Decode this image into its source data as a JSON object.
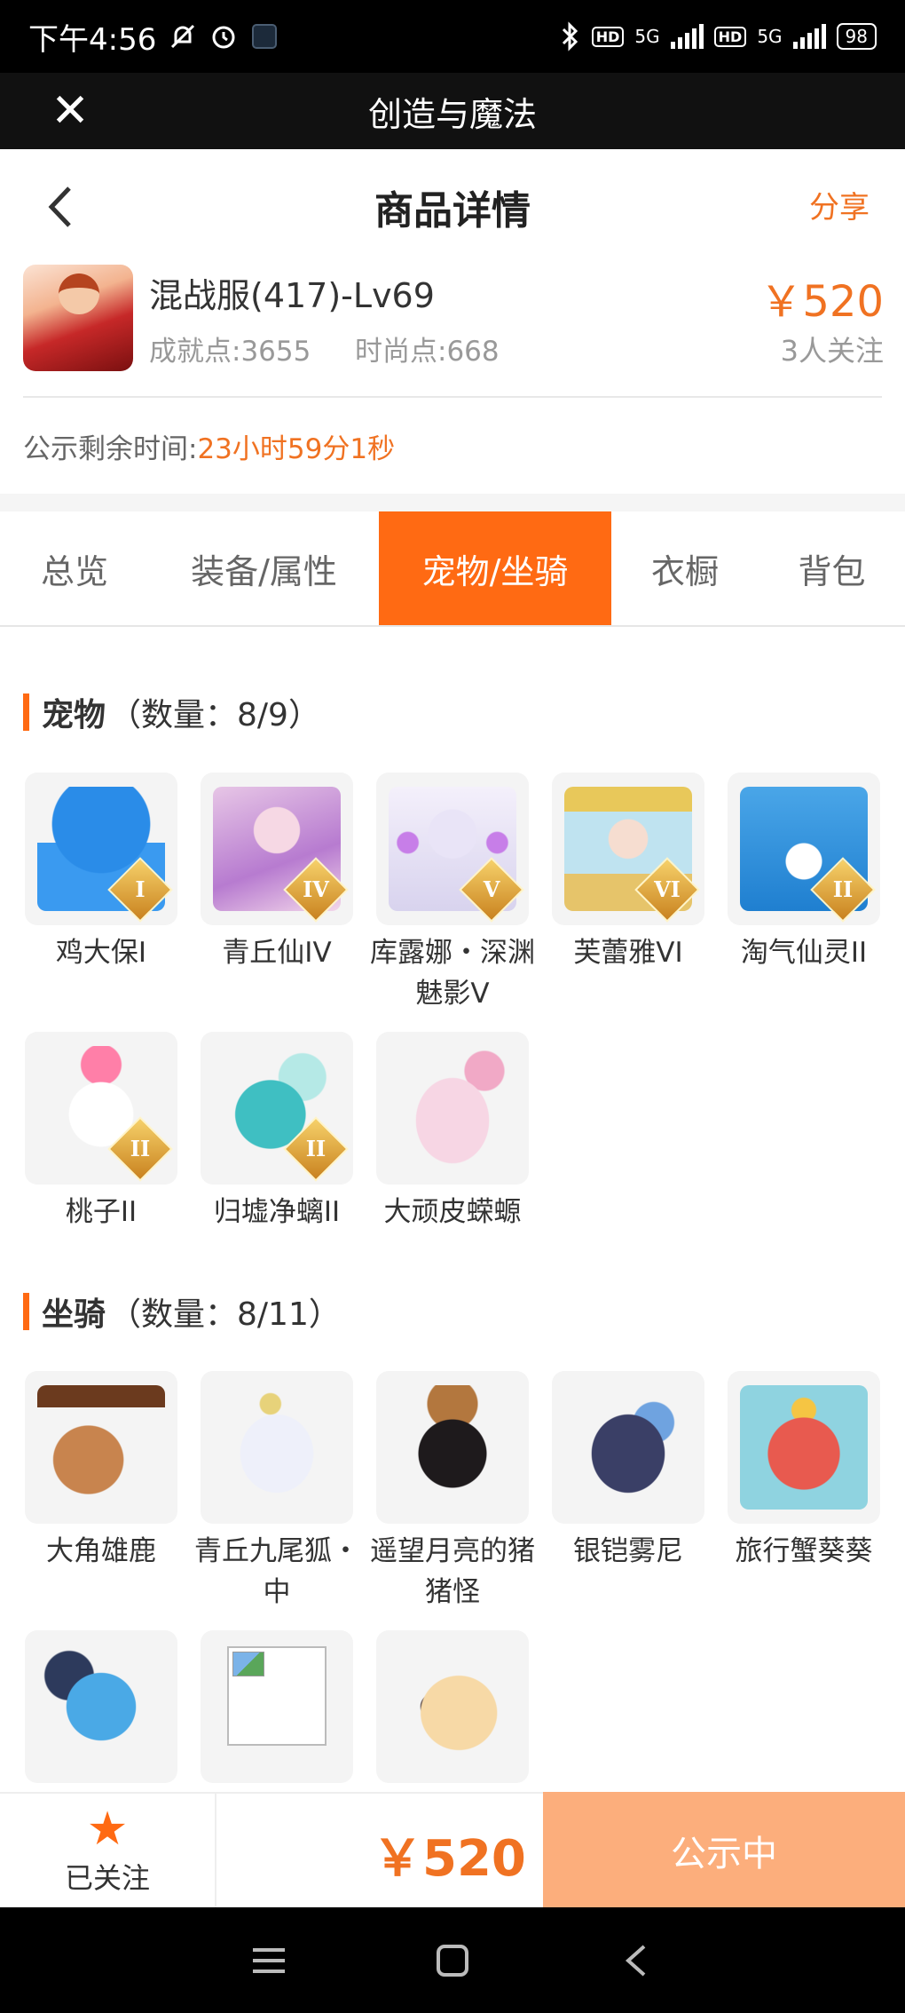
{
  "status_bar": {
    "time": "下午4:56",
    "network_1": "5G",
    "network_2": "5G",
    "hd_1": "HD",
    "hd_2": "HD",
    "battery": "98"
  },
  "app_bar": {
    "title": "创造与魔法"
  },
  "header": {
    "title": "商品详情",
    "share": "分享"
  },
  "product": {
    "name": "混战服(417)-Lv69",
    "achievement": "成就点:3655",
    "fashion": "时尚点:668",
    "price": "￥520",
    "followers": "3人关注"
  },
  "countdown": {
    "label": "公示剩余时间:",
    "value": "23小时59分1秒"
  },
  "tabs": [
    {
      "label": "总览",
      "active": false
    },
    {
      "label": "装备/属性",
      "active": false
    },
    {
      "label": "宠物/坐骑",
      "active": true
    },
    {
      "label": "衣橱",
      "active": false
    },
    {
      "label": "背包",
      "active": false
    }
  ],
  "pets": {
    "title": "宠物",
    "count": "（数量：8/9）",
    "items": [
      {
        "label": "鸡大保I",
        "badge": "I",
        "icon": "blue-chicken-icon"
      },
      {
        "label": "青丘仙IV",
        "badge": "IV",
        "icon": "fox-fairy-icon"
      },
      {
        "label": "库露娜・深渊魅影V",
        "badge": "V",
        "icon": "kuluna-icon"
      },
      {
        "label": "芙蕾雅VI",
        "badge": "VI",
        "icon": "freya-icon"
      },
      {
        "label": "淘气仙灵II",
        "badge": "II",
        "icon": "blue-puppy-icon"
      },
      {
        "label": "桃子II",
        "badge": "II",
        "icon": "pink-cat-icon"
      },
      {
        "label": "归墟净螭II",
        "badge": "II",
        "icon": "cyan-dragon-icon"
      },
      {
        "label": "大顽皮蝾螈",
        "badge": "",
        "icon": "axolotl-icon"
      }
    ]
  },
  "mounts": {
    "title": "坐骑",
    "count": "（数量：8/11）",
    "items": [
      {
        "label": "大角雄鹿",
        "icon": "stag-icon"
      },
      {
        "label": "青丘九尾狐・中",
        "icon": "nine-tail-fox-icon"
      },
      {
        "label": "遥望月亮的猪猪怪",
        "icon": "pig-monster-icon"
      },
      {
        "label": "银铠雾尼",
        "icon": "armored-beast-icon"
      },
      {
        "label": "旅行蟹葵葵",
        "icon": "crab-icon"
      },
      {
        "label": "",
        "icon": "blue-dragon-icon"
      },
      {
        "label": "",
        "icon": "broken-image-icon"
      },
      {
        "label": "",
        "icon": "parrot-icon"
      }
    ]
  },
  "bottom_bar": {
    "follow_label": "已关注",
    "price": "￥520",
    "status_button": "公示中"
  },
  "colors": {
    "accent": "#ff6a13",
    "price": "#f07222",
    "status_button": "#fcae7c"
  }
}
